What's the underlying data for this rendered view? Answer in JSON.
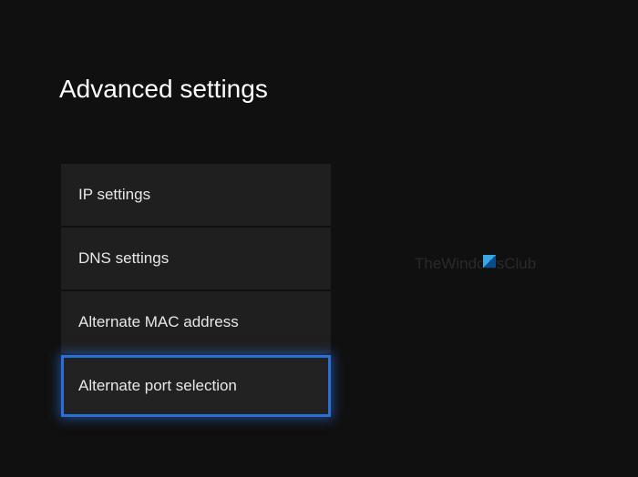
{
  "header": {
    "title": "Advanced settings"
  },
  "menu": {
    "items": [
      {
        "label": "IP settings",
        "selected": false
      },
      {
        "label": "DNS settings",
        "selected": false
      },
      {
        "label": "Alternate MAC address",
        "selected": false
      },
      {
        "label": "Alternate port selection",
        "selected": true
      }
    ]
  },
  "watermark": {
    "text": "TheWindowsClub"
  }
}
